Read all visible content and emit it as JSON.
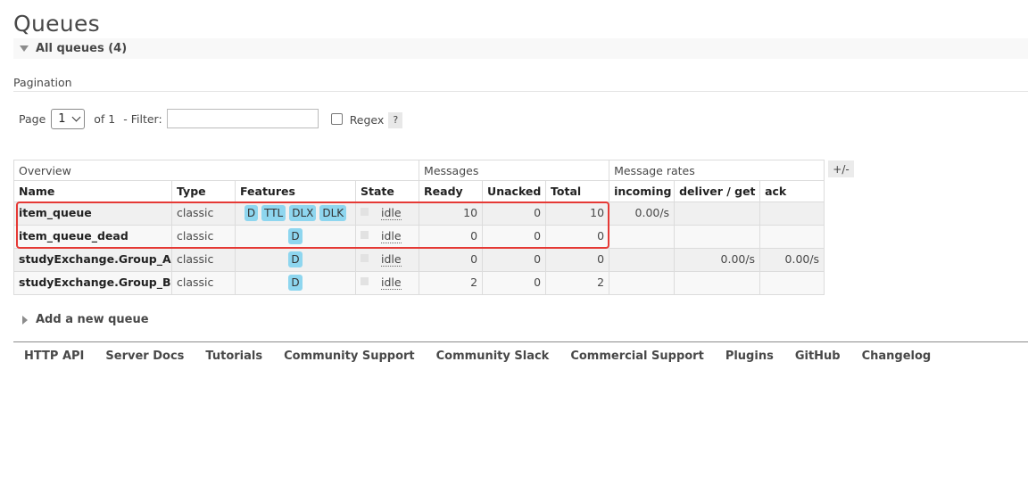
{
  "page": {
    "title": "Queues"
  },
  "section": {
    "title": "All queues (4)"
  },
  "pagination": {
    "heading": "Pagination",
    "page_label": "Page",
    "page_value": "1",
    "of_label": "of 1",
    "filter_label": "- Filter:",
    "filter_value": "",
    "regex_label": "Regex",
    "help_label": "?"
  },
  "table": {
    "groups": [
      "Overview",
      "Messages",
      "Message rates"
    ],
    "headers": [
      "Name",
      "Type",
      "Features",
      "State",
      "Ready",
      "Unacked",
      "Total",
      "incoming",
      "deliver / get",
      "ack"
    ],
    "rows": [
      {
        "name": "item_queue",
        "type": "classic",
        "features": [
          "D",
          "TTL",
          "DLX",
          "DLK"
        ],
        "state": "idle",
        "ready": "10",
        "unacked": "0",
        "total": "10",
        "incoming": "0.00/s",
        "deliver_get": "",
        "ack": ""
      },
      {
        "name": "item_queue_dead",
        "type": "classic",
        "features": [
          "D"
        ],
        "state": "idle",
        "ready": "0",
        "unacked": "0",
        "total": "0",
        "incoming": "",
        "deliver_get": "",
        "ack": ""
      },
      {
        "name": "studyExchange.Group_A",
        "type": "classic",
        "features": [
          "D"
        ],
        "state": "idle",
        "ready": "0",
        "unacked": "0",
        "total": "0",
        "incoming": "",
        "deliver_get": "0.00/s",
        "ack": "0.00/s"
      },
      {
        "name": "studyExchange.Group_B",
        "type": "classic",
        "features": [
          "D"
        ],
        "state": "idle",
        "ready": "2",
        "unacked": "0",
        "total": "2",
        "incoming": "",
        "deliver_get": "",
        "ack": ""
      }
    ],
    "columns_toggle": "+/-"
  },
  "add_queue": {
    "label": "Add a new queue"
  },
  "footer": {
    "links": [
      "HTTP API",
      "Server Docs",
      "Tutorials",
      "Community Support",
      "Community Slack",
      "Commercial Support",
      "Plugins",
      "GitHub",
      "Changelog"
    ]
  },
  "colors": {
    "feature_badge": "#8ed6ef",
    "highlight_annotation": "#e53935",
    "text": "#484848"
  }
}
